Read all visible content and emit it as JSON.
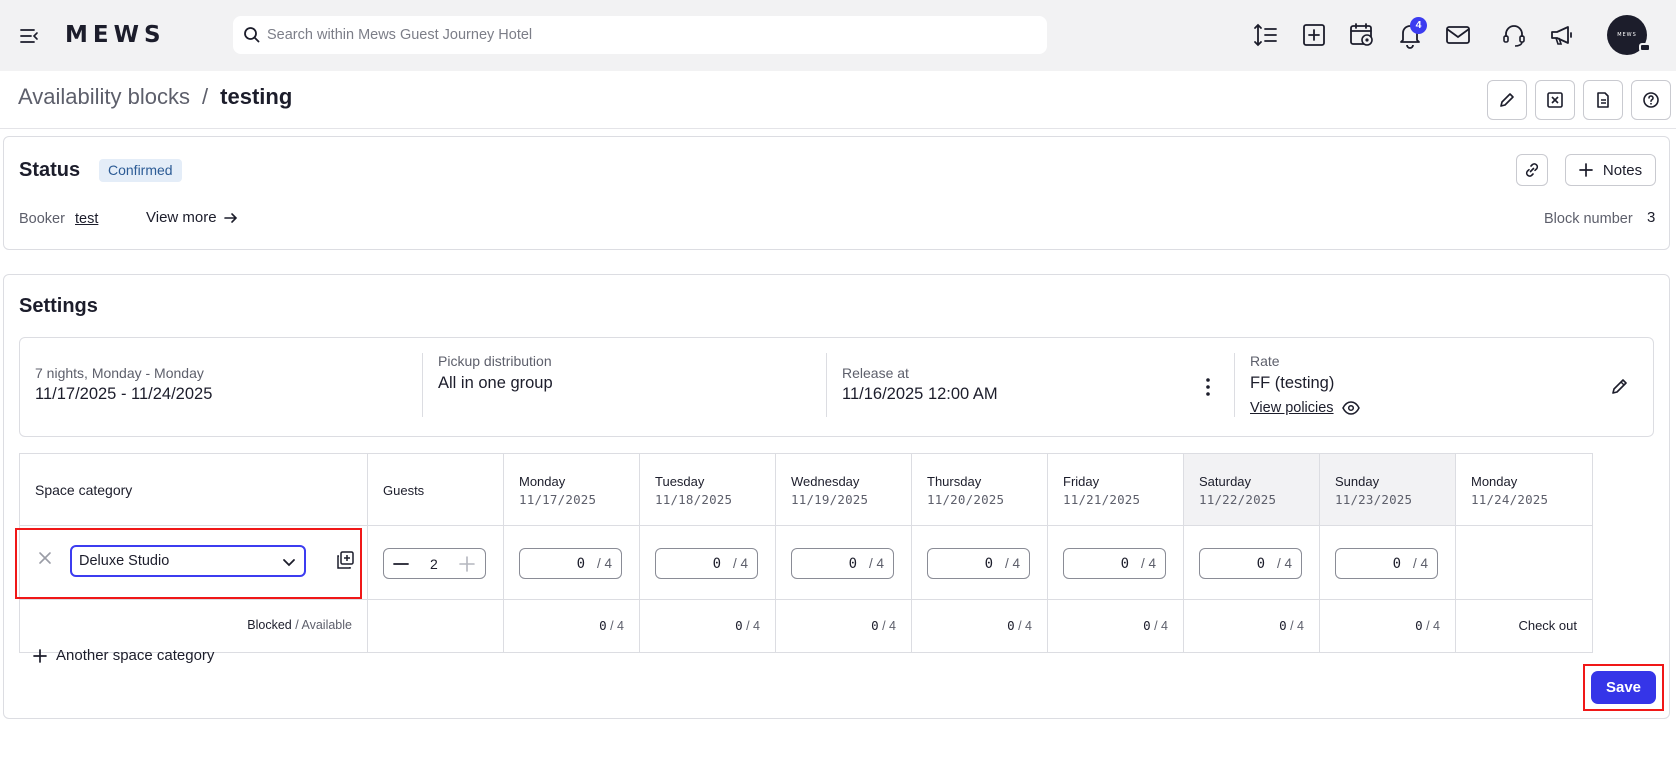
{
  "app": {
    "logo_text": "MEWS",
    "search_placeholder": "Search within Mews Guest Journey Hotel",
    "notifications_count": "4",
    "avatar_text": "MEWS"
  },
  "header": {
    "breadcrumb_parent": "Availability blocks",
    "breadcrumb_separator": "/",
    "breadcrumb_current": "testing"
  },
  "status": {
    "title": "Status",
    "badge": "Confirmed",
    "booker_label": "Booker",
    "booker_value": "test",
    "view_more": "View more",
    "block_number_label": "Block number",
    "block_number_value": "3",
    "notes_label": "Notes"
  },
  "settings": {
    "title": "Settings",
    "dates": {
      "label": "7 nights, Monday - Monday",
      "value": "11/17/2025 - 11/24/2025"
    },
    "pickup": {
      "label": "Pickup distribution",
      "value": "All in one group"
    },
    "release": {
      "label": "Release at",
      "value": "11/16/2025 12:00 AM"
    },
    "rate": {
      "label": "Rate",
      "value": "FF (testing)",
      "policies_link": "View policies"
    }
  },
  "table": {
    "col_space_category": "Space category",
    "col_guests": "Guests",
    "days": [
      {
        "name": "Monday",
        "date": "11/17/2025",
        "value": "0",
        "total": "/ 4",
        "blocked": "0",
        "available": "/ 4"
      },
      {
        "name": "Tuesday",
        "date": "11/18/2025",
        "value": "0",
        "total": "/ 4",
        "blocked": "0",
        "available": "/ 4"
      },
      {
        "name": "Wednesday",
        "date": "11/19/2025",
        "value": "0",
        "total": "/ 4",
        "blocked": "0",
        "available": "/ 4"
      },
      {
        "name": "Thursday",
        "date": "11/20/2025",
        "value": "0",
        "total": "/ 4",
        "blocked": "0",
        "available": "/ 4"
      },
      {
        "name": "Friday",
        "date": "11/21/2025",
        "value": "0",
        "total": "/ 4",
        "blocked": "0",
        "available": "/ 4"
      },
      {
        "name": "Saturday",
        "date": "11/22/2025",
        "value": "0",
        "total": "/ 4",
        "blocked": "0",
        "available": "/ 4"
      },
      {
        "name": "Sunday",
        "date": "11/23/2025",
        "value": "0",
        "total": "/ 4",
        "blocked": "0",
        "available": "/ 4"
      },
      {
        "name": "Monday",
        "date": "11/24/2025"
      }
    ],
    "row": {
      "category": "Deluxe Studio",
      "guests": "2"
    },
    "blocked_label": "Blocked",
    "available_label": "/ Available",
    "check_out": "Check out"
  },
  "actions": {
    "another_category": "Another space category",
    "save": "Save"
  },
  "colors": {
    "accent": "#3535e8",
    "highlight": "#f01818",
    "badge_bg": "#e4edf8"
  }
}
